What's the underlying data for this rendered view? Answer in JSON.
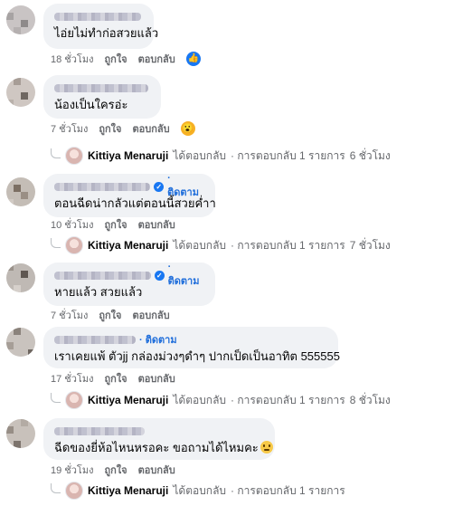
{
  "comments": [
    {
      "text": "ไอ่ยไม่ทำก่อสวยแล้ว",
      "time": "18 ชั่วโมง",
      "like": "ถูกใจ",
      "reply": "ตอบกลับ",
      "reaction": "like-icon"
    },
    {
      "text": "น้องเป็นใครอ่ะ",
      "time": "7 ชั่วโมง",
      "like": "ถูกใจ",
      "reply": "ตอบกลับ",
      "reaction": "wow-icon",
      "reply_summary": {
        "who": "Kittiya Menaruji",
        "action": "ได้ตอบกลับ",
        "count": "· การตอบกลับ 1 รายการ",
        "age": "6 ชั่วโมง"
      }
    },
    {
      "follow": "· ติดตาม",
      "text": "ตอนฉีดน่ากลัวแต่ตอนนี้สวยค่ำา",
      "time": "10 ชั่วโมง",
      "like": "ถูกใจ",
      "reply": "ตอบกลับ",
      "reply_summary": {
        "who": "Kittiya Menaruji",
        "action": "ได้ตอบกลับ",
        "count": "· การตอบกลับ 1 รายการ",
        "age": "7 ชั่วโมง"
      }
    },
    {
      "follow": "· ติดตาม",
      "text": "หายแล้ว สวยแล้ว",
      "time": "7 ชั่วโมง",
      "like": "ถูกใจ",
      "reply": "ตอบกลับ"
    },
    {
      "follow": "· ติดตาม",
      "text": "เราเคยแพ้ ตัวjj กล่องม่วงๆดำๆ ปากเป็ดเป็นอาทิต 555555",
      "time": "17 ชั่วโมง",
      "like": "ถูกใจ",
      "reply": "ตอบกลับ",
      "reply_summary": {
        "who": "Kittiya Menaruji",
        "action": "ได้ตอบกลับ",
        "count": "· การตอบกลับ 1 รายการ",
        "age": "8 ชั่วโมง"
      }
    },
    {
      "text": "ฉีดของยี่ห้อไหนหรอคะ ขอถามได้ไหมคะ",
      "time": "19 ชั่วโมง",
      "like": "ถูกใจ",
      "reply": "ตอบกลับ",
      "reply_summary": {
        "who": "Kittiya Menaruji",
        "action": "ได้ตอบกลับ",
        "count": "· การตอบกลับ 1 รายการ",
        "age": ""
      }
    }
  ]
}
